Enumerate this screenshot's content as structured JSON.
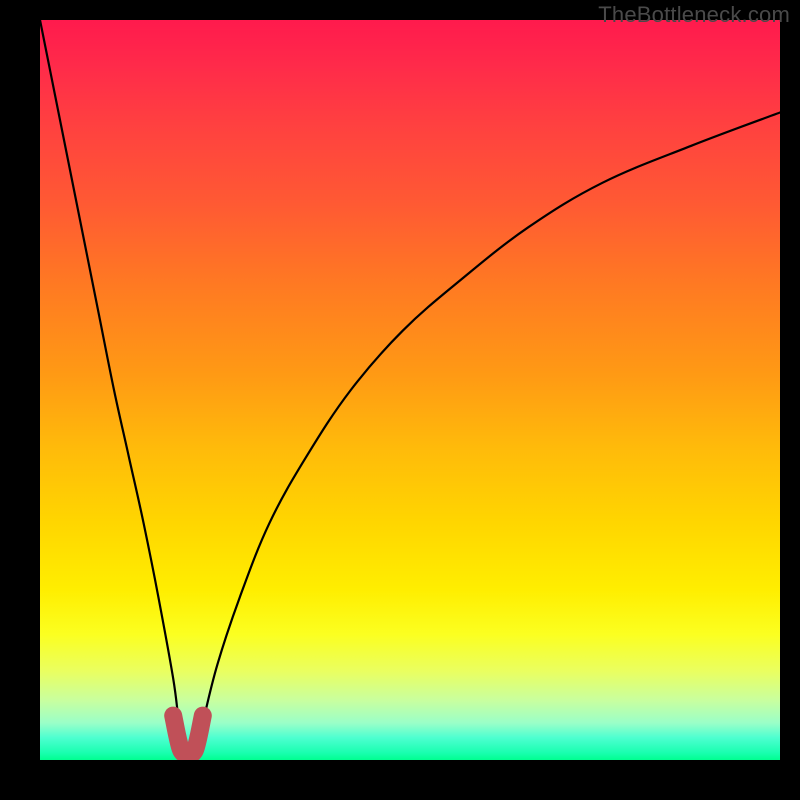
{
  "watermark": "TheBottleneck.com",
  "colors": {
    "curve": "#000000",
    "marker": "#c05058",
    "frame": "#000000"
  },
  "chart_data": {
    "type": "line",
    "title": "",
    "xlabel": "",
    "ylabel": "",
    "xlim": [
      0,
      100
    ],
    "ylim": [
      0,
      100
    ],
    "grid": false,
    "legend": false,
    "series": [
      {
        "name": "bottleneck-curve",
        "x": [
          0,
          2,
          4,
          6,
          8,
          10,
          12,
          14,
          16,
          18,
          18.8,
          19.6,
          20.4,
          21.2,
          22,
          24,
          27,
          31,
          36,
          42,
          49,
          57,
          66,
          76,
          88,
          100
        ],
        "y": [
          100,
          90,
          80,
          70,
          60,
          50,
          41,
          32,
          22,
          11,
          5,
          1.2,
          0.5,
          1.2,
          5,
          13,
          22,
          32,
          41,
          50,
          58,
          65,
          72,
          78,
          83,
          87.5
        ]
      },
      {
        "name": "marker-band",
        "x": [
          18,
          18.5,
          19,
          19.5,
          20,
          20.5,
          21,
          21.5,
          22
        ],
        "y": [
          6,
          3.5,
          1.5,
          0.8,
          0.5,
          0.8,
          1.5,
          3.5,
          6
        ]
      }
    ],
    "annotations": []
  }
}
